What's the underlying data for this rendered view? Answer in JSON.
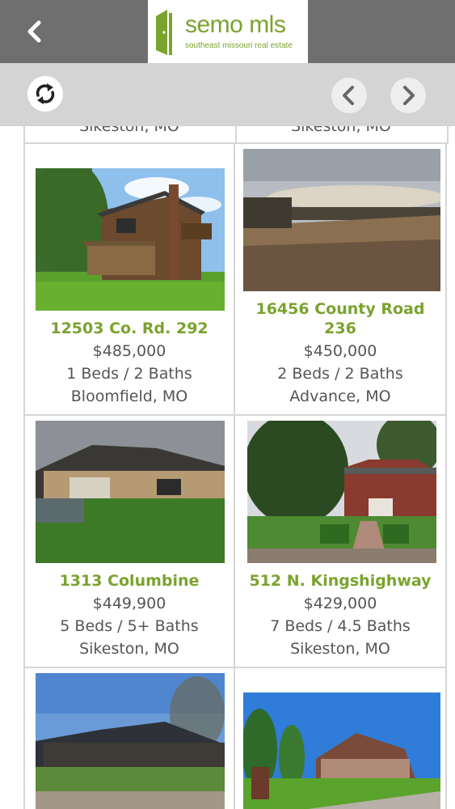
{
  "header": {
    "logo_name": "semo mls",
    "logo_tagline": "southeast missouri real estate"
  },
  "toolbar": {
    "refresh_icon": "refresh-icon",
    "prev_icon": "chevron-left-icon",
    "next_icon": "chevron-right-icon"
  },
  "partial_row": [
    "Sikeston, MO",
    "Sikeston, MO"
  ],
  "listings": [
    {
      "address_line1": "12503 Co. Rd. 292",
      "address_line2": "",
      "price": "$485,000",
      "beds_baths": "1 Beds / 2 Baths",
      "city": "Bloomfield, MO"
    },
    {
      "address_line1": "16456 County Road",
      "address_line2": "236",
      "price": "$450,000",
      "beds_baths": "2 Beds / 2 Baths",
      "city": "Advance, MO"
    },
    {
      "address_line1": "1313 Columbine",
      "address_line2": "",
      "price": "$449,900",
      "beds_baths": "5 Beds / 5+ Baths",
      "city": "Sikeston, MO"
    },
    {
      "address_line1": "512 N. Kingshighway",
      "address_line2": "",
      "price": "$429,000",
      "beds_baths": "7 Beds / 4.5 Baths",
      "city": "Sikeston, MO"
    }
  ],
  "colors": {
    "accent": "#7aa32e",
    "header_bg": "#6f6f6f",
    "toolbar_bg": "#d4d4d4"
  }
}
